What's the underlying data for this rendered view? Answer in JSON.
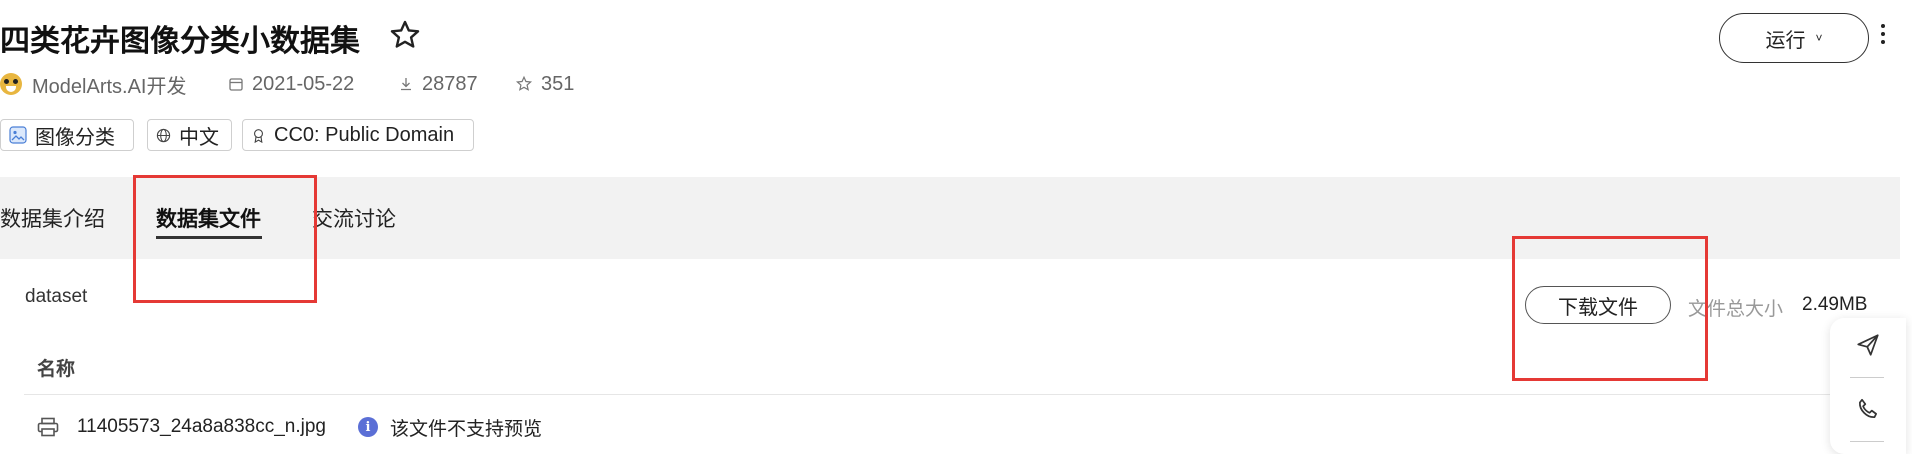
{
  "header": {
    "title": "四类花卉图像分类小数据集",
    "author": "ModelArts.AI开发",
    "date": "2021-05-22",
    "downloads": "28787",
    "stars": "351"
  },
  "tags": [
    {
      "label": "图像分类",
      "icon": "image-icon"
    },
    {
      "label": "中文",
      "icon": "globe-icon"
    },
    {
      "label": "CC0: Public Domain",
      "icon": "license-icon"
    }
  ],
  "actions": {
    "run_label": "运行",
    "run_chevron": "˅"
  },
  "tabs": [
    {
      "label": "数据集介绍",
      "active": false
    },
    {
      "label": "数据集文件",
      "active": true
    },
    {
      "label": "交流讨论",
      "active": false
    }
  ],
  "files": {
    "folder": "dataset",
    "download_label": "下载文件",
    "total_size_label": "文件总大小",
    "total_size_value": "2.49MB",
    "column_name": "名称",
    "rows": [
      {
        "name": "11405573_24a8a838cc_n.jpg",
        "notice": "该文件不支持预览",
        "info_glyph": "i"
      }
    ]
  },
  "colors": {
    "highlight": "#e53935",
    "info": "#5b6fd6",
    "tab_bar_bg": "#f2f2f2"
  }
}
